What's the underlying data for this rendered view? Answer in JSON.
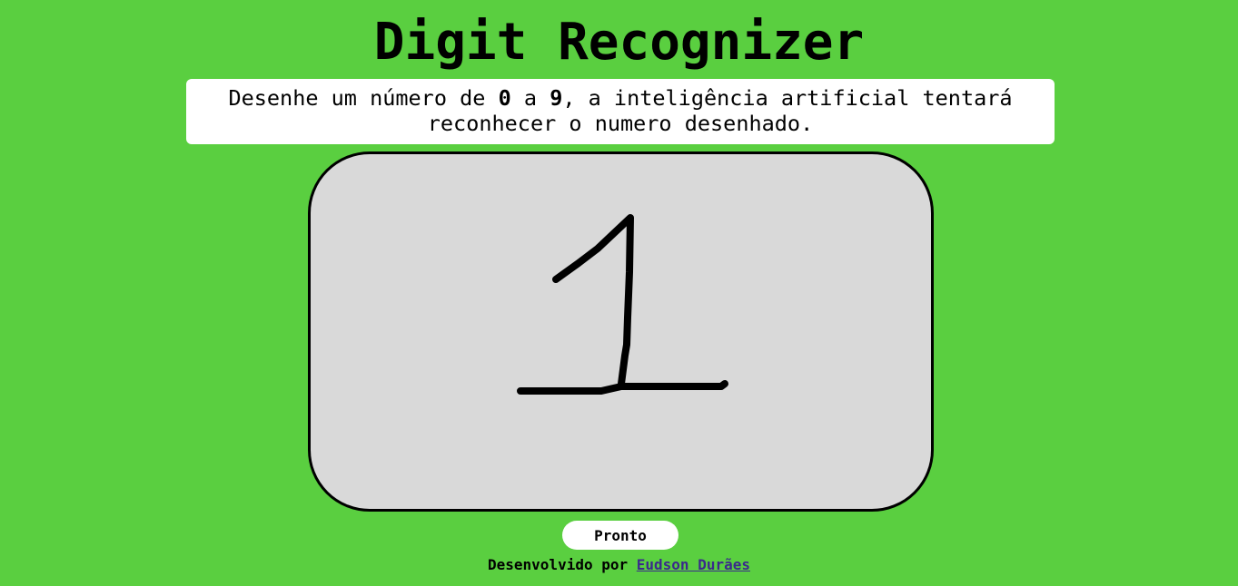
{
  "header": {
    "title": "Digit Recognizer"
  },
  "instructions": {
    "part1": "Desenhe um número de ",
    "digit_min": "0",
    "part2": " a ",
    "digit_max": "9",
    "part3": ", a inteligência artificial tentará reconhecer o numero desenhado."
  },
  "drawing": {
    "background_color": "#d9d9d9",
    "stroke_color": "#000000"
  },
  "actions": {
    "ready_label": "Pronto"
  },
  "footer": {
    "credit_prefix": "Desenvolvido por ",
    "author_name": "Eudson Durães"
  },
  "colors": {
    "page_background": "#5acf40",
    "link": "#3b2a8c"
  }
}
